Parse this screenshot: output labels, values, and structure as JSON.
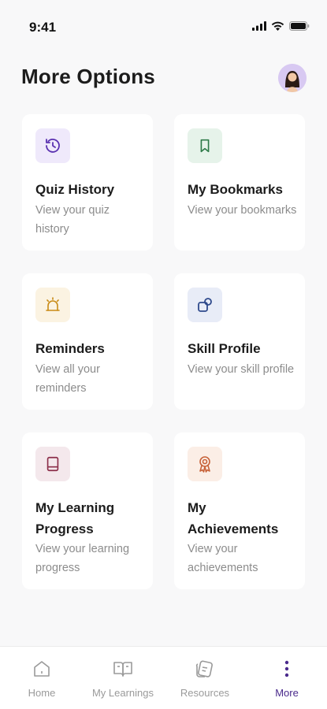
{
  "status_bar": {
    "time": "9:41"
  },
  "header": {
    "title": "More Options"
  },
  "cards": [
    {
      "title": "Quiz History",
      "description": "View your quiz history",
      "icon": "history-icon",
      "icon_bg": "#efe9fb",
      "icon_color": "#5a31b0"
    },
    {
      "title": "My Bookmarks",
      "description": "View your bookmarks",
      "icon": "bookmark-icon",
      "icon_bg": "#e6f3ea",
      "icon_color": "#2e7a48"
    },
    {
      "title": "Reminders",
      "description": "View all your reminders",
      "icon": "alarm-icon",
      "icon_bg": "#fbf3e2",
      "icon_color": "#c98b16"
    },
    {
      "title": "Skill Profile",
      "description": "View your skill profile",
      "icon": "shapes-icon",
      "icon_bg": "#e8ecf7",
      "icon_color": "#2f4a8c"
    },
    {
      "title": "My Learning Progress",
      "description": "View your learning progress",
      "icon": "book-icon",
      "icon_bg": "#f4e8ec",
      "icon_color": "#8c2f4a"
    },
    {
      "title": "My Achievements",
      "description": "View your achievements",
      "icon": "badge-icon",
      "icon_bg": "#fbeee6",
      "icon_color": "#c8633a"
    }
  ],
  "bottom_nav": {
    "active": "More",
    "items": [
      {
        "label": "Home",
        "icon": "home-icon"
      },
      {
        "label": "My Learnings",
        "icon": "open-book-icon"
      },
      {
        "label": "Resources",
        "icon": "resources-icon"
      },
      {
        "label": "More",
        "icon": "more-vertical-icon"
      }
    ]
  }
}
